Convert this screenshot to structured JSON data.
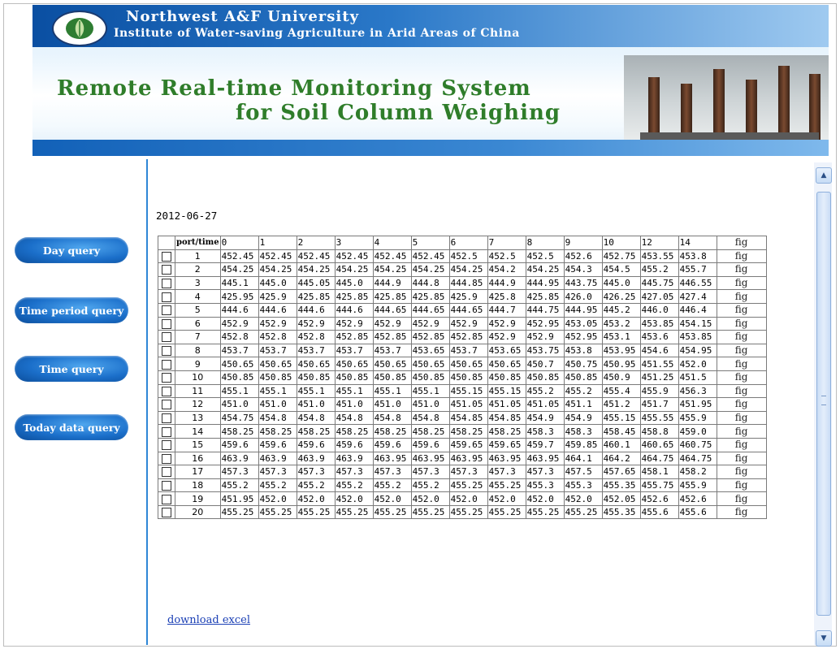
{
  "header": {
    "university": "Northwest A&F University",
    "institute": "Institute of Water-saving Agriculture in Arid Areas of China",
    "system_line1": "Remote Real-time Monitoring System",
    "system_line2": "for Soil Column Weighing"
  },
  "menu": [
    {
      "label": "Day query"
    },
    {
      "label": "Time period query"
    },
    {
      "label": "Time query"
    },
    {
      "label": "Today data query"
    }
  ],
  "date": "2012-06-27",
  "table": {
    "headers": [
      "port/time",
      "0",
      "1",
      "2",
      "3",
      "4",
      "5",
      "6",
      "7",
      "8",
      "9",
      "10",
      "12",
      "14",
      "fig"
    ],
    "fig_label": "fig",
    "rows": [
      {
        "port": "1",
        "values": [
          "452.45",
          "452.45",
          "452.45",
          "452.45",
          "452.45",
          "452.45",
          "452.5",
          "452.5",
          "452.5",
          "452.6",
          "452.75",
          "453.55",
          "453.8"
        ]
      },
      {
        "port": "2",
        "values": [
          "454.25",
          "454.25",
          "454.25",
          "454.25",
          "454.25",
          "454.25",
          "454.25",
          "454.2",
          "454.25",
          "454.3",
          "454.5",
          "455.2",
          "455.7"
        ]
      },
      {
        "port": "3",
        "values": [
          "445.1",
          "445.0",
          "445.05",
          "445.0",
          "444.9",
          "444.8",
          "444.85",
          "444.9",
          "444.95",
          "443.75",
          "445.0",
          "445.75",
          "446.55"
        ]
      },
      {
        "port": "4",
        "values": [
          "425.95",
          "425.9",
          "425.85",
          "425.85",
          "425.85",
          "425.85",
          "425.9",
          "425.8",
          "425.85",
          "426.0",
          "426.25",
          "427.05",
          "427.4"
        ]
      },
      {
        "port": "5",
        "values": [
          "444.6",
          "444.6",
          "444.6",
          "444.6",
          "444.65",
          "444.65",
          "444.65",
          "444.7",
          "444.75",
          "444.95",
          "445.2",
          "446.0",
          "446.4"
        ]
      },
      {
        "port": "6",
        "values": [
          "452.9",
          "452.9",
          "452.9",
          "452.9",
          "452.9",
          "452.9",
          "452.9",
          "452.9",
          "452.95",
          "453.05",
          "453.2",
          "453.85",
          "454.15"
        ]
      },
      {
        "port": "7",
        "values": [
          "452.8",
          "452.8",
          "452.8",
          "452.85",
          "452.85",
          "452.85",
          "452.85",
          "452.9",
          "452.9",
          "452.95",
          "453.1",
          "453.6",
          "453.85"
        ]
      },
      {
        "port": "8",
        "values": [
          "453.7",
          "453.7",
          "453.7",
          "453.7",
          "453.7",
          "453.65",
          "453.7",
          "453.65",
          "453.75",
          "453.8",
          "453.95",
          "454.6",
          "454.95"
        ]
      },
      {
        "port": "9",
        "values": [
          "450.65",
          "450.65",
          "450.65",
          "450.65",
          "450.65",
          "450.65",
          "450.65",
          "450.65",
          "450.7",
          "450.75",
          "450.95",
          "451.55",
          "452.0"
        ]
      },
      {
        "port": "10",
        "values": [
          "450.85",
          "450.85",
          "450.85",
          "450.85",
          "450.85",
          "450.85",
          "450.85",
          "450.85",
          "450.85",
          "450.85",
          "450.9",
          "451.25",
          "451.5"
        ]
      },
      {
        "port": "11",
        "values": [
          "455.1",
          "455.1",
          "455.1",
          "455.1",
          "455.1",
          "455.1",
          "455.15",
          "455.15",
          "455.2",
          "455.2",
          "455.4",
          "455.9",
          "456.3"
        ]
      },
      {
        "port": "12",
        "values": [
          "451.0",
          "451.0",
          "451.0",
          "451.0",
          "451.0",
          "451.0",
          "451.05",
          "451.05",
          "451.05",
          "451.1",
          "451.2",
          "451.7",
          "451.95"
        ]
      },
      {
        "port": "13",
        "values": [
          "454.75",
          "454.8",
          "454.8",
          "454.8",
          "454.8",
          "454.8",
          "454.85",
          "454.85",
          "454.9",
          "454.9",
          "455.15",
          "455.55",
          "455.9"
        ]
      },
      {
        "port": "14",
        "values": [
          "458.25",
          "458.25",
          "458.25",
          "458.25",
          "458.25",
          "458.25",
          "458.25",
          "458.25",
          "458.3",
          "458.3",
          "458.45",
          "458.8",
          "459.0"
        ]
      },
      {
        "port": "15",
        "values": [
          "459.6",
          "459.6",
          "459.6",
          "459.6",
          "459.6",
          "459.6",
          "459.65",
          "459.65",
          "459.7",
          "459.85",
          "460.1",
          "460.65",
          "460.75"
        ]
      },
      {
        "port": "16",
        "values": [
          "463.9",
          "463.9",
          "463.9",
          "463.9",
          "463.95",
          "463.95",
          "463.95",
          "463.95",
          "463.95",
          "464.1",
          "464.2",
          "464.75",
          "464.75"
        ]
      },
      {
        "port": "17",
        "values": [
          "457.3",
          "457.3",
          "457.3",
          "457.3",
          "457.3",
          "457.3",
          "457.3",
          "457.3",
          "457.3",
          "457.5",
          "457.65",
          "458.1",
          "458.2"
        ]
      },
      {
        "port": "18",
        "values": [
          "455.2",
          "455.2",
          "455.2",
          "455.2",
          "455.2",
          "455.2",
          "455.25",
          "455.25",
          "455.3",
          "455.3",
          "455.35",
          "455.75",
          "455.9"
        ]
      },
      {
        "port": "19",
        "values": [
          "451.95",
          "452.0",
          "452.0",
          "452.0",
          "452.0",
          "452.0",
          "452.0",
          "452.0",
          "452.0",
          "452.0",
          "452.05",
          "452.6",
          "452.6"
        ]
      },
      {
        "port": "20",
        "values": [
          "455.25",
          "455.25",
          "455.25",
          "455.25",
          "455.25",
          "455.25",
          "455.25",
          "455.25",
          "455.25",
          "455.25",
          "455.35",
          "455.6",
          "455.6"
        ]
      }
    ]
  },
  "download_label": "download excel",
  "colors": {
    "header_blue": "#0a4fa2",
    "title_green": "#2f7d2a",
    "menu_blue": "#1b6fca",
    "link_blue": "#1a3fb5"
  }
}
